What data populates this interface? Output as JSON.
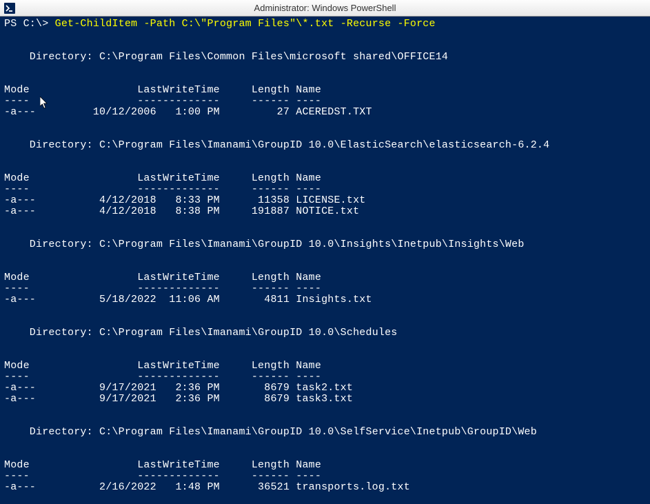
{
  "window": {
    "title": "Administrator: Windows PowerShell"
  },
  "prompt": "PS C:\\> ",
  "command": "Get-ChildItem -Path C:\\\"Program Files\"\\*.txt -Recurse -Force",
  "headers": {
    "mode": "Mode",
    "lwt": "LastWriteTime",
    "length": "Length",
    "name": "Name",
    "sep_mode": "----",
    "sep_lwt": "-------------",
    "sep_len": "------",
    "sep_name": "----"
  },
  "dirlabel": "    Directory: ",
  "sections": [
    {
      "path": "C:\\Program Files\\Common Files\\microsoft shared\\OFFICE14",
      "files": [
        {
          "mode": "-a---",
          "date": "10/12/2006",
          "time": " 1:00 PM",
          "length": "27",
          "name": "ACEREDST.TXT"
        }
      ]
    },
    {
      "path": "C:\\Program Files\\Imanami\\GroupID 10.0\\ElasticSearch\\elasticsearch-6.2.4",
      "files": [
        {
          "mode": "-a---",
          "date": "4/12/2018",
          "time": " 8:33 PM",
          "length": "11358",
          "name": "LICENSE.txt"
        },
        {
          "mode": "-a---",
          "date": "4/12/2018",
          "time": " 8:38 PM",
          "length": "191887",
          "name": "NOTICE.txt"
        }
      ]
    },
    {
      "path": "C:\\Program Files\\Imanami\\GroupID 10.0\\Insights\\Inetpub\\Insights\\Web",
      "files": [
        {
          "mode": "-a---",
          "date": "5/18/2022",
          "time": "11:06 AM",
          "length": "4811",
          "name": "Insights.txt"
        }
      ]
    },
    {
      "path": "C:\\Program Files\\Imanami\\GroupID 10.0\\Schedules",
      "files": [
        {
          "mode": "-a---",
          "date": "9/17/2021",
          "time": " 2:36 PM",
          "length": "8679",
          "name": "task2.txt"
        },
        {
          "mode": "-a---",
          "date": "9/17/2021",
          "time": " 2:36 PM",
          "length": "8679",
          "name": "task3.txt"
        }
      ]
    },
    {
      "path": "C:\\Program Files\\Imanami\\GroupID 10.0\\SelfService\\Inetpub\\GroupID\\Web",
      "files": [
        {
          "mode": "-a---",
          "date": "2/16/2022",
          "time": " 1:48 PM",
          "length": "36521",
          "name": "transports.log.txt"
        }
      ]
    }
  ]
}
